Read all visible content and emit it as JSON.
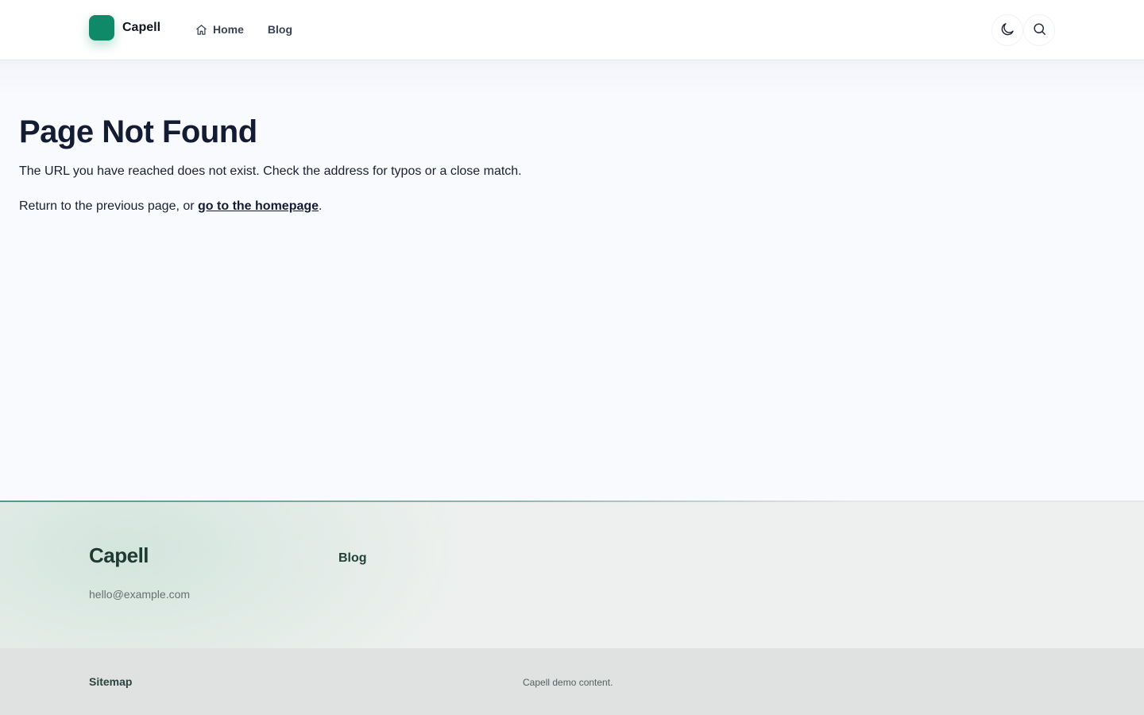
{
  "header": {
    "brand_name": "Capell",
    "nav": [
      {
        "label": "Home",
        "icon": "home-icon"
      },
      {
        "label": "Blog"
      }
    ],
    "actions": [
      {
        "icon": "moon-icon"
      },
      {
        "icon": "search-icon"
      }
    ]
  },
  "main": {
    "title": "Page Not Found",
    "paragraph_1": "The URL you have reached does not exist. Check the address for typos or a close match.",
    "paragraph_2_prefix": "Return to the previous page, or ",
    "homepage_link": "go to the homepage",
    "paragraph_2_suffix": "."
  },
  "footer": {
    "brand_name": "Capell",
    "email": "hello@example.com",
    "link_blog": "Blog",
    "sitemap": "Sitemap",
    "copyright": "Capell demo content."
  },
  "colors": {
    "accent": "#0e8a69",
    "heading": "#141c33",
    "footer_bg": "#edf0ee",
    "footer_bottom_bg": "#dfe2e1"
  }
}
